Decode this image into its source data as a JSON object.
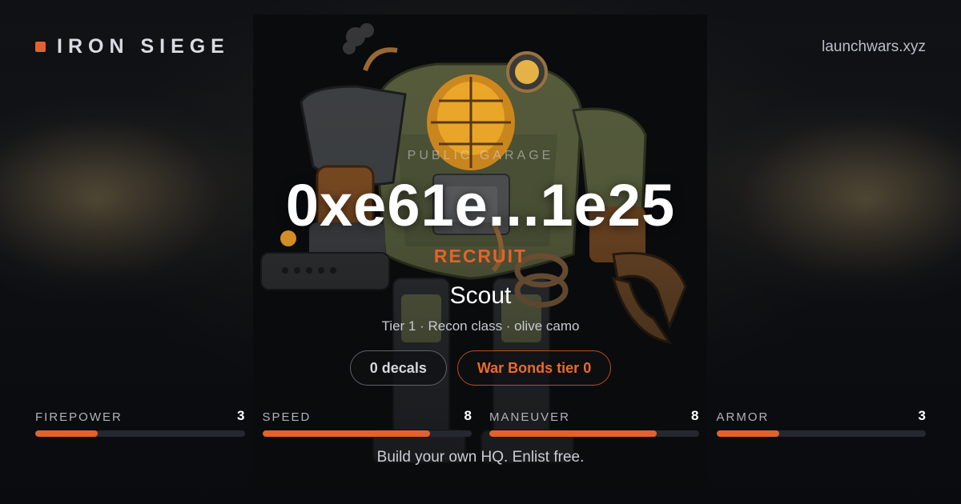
{
  "brand": {
    "name": "IRON SIEGE",
    "accent": "#e4622a"
  },
  "domain": "launchwars.xyz",
  "hero": {
    "eyebrow": "PUBLIC GARAGE",
    "address": "0xe61e...1e25",
    "rank": "RECRUIT",
    "unit_name": "Scout",
    "meta": "Tier 1 · Recon class · olive camo",
    "image_subject": "olive steampunk mech robot"
  },
  "pills": {
    "decals": "0 decals",
    "bonds": "War Bonds tier 0"
  },
  "stats": [
    {
      "label": "FIREPOWER",
      "value": "3",
      "level": 0.3
    },
    {
      "label": "SPEED",
      "value": "8",
      "level": 0.8
    },
    {
      "label": "MANEUVER",
      "value": "8",
      "level": 0.8
    },
    {
      "label": "ARMOR",
      "value": "3",
      "level": 0.3
    }
  ],
  "cta": "Build your own HQ. Enlist free."
}
